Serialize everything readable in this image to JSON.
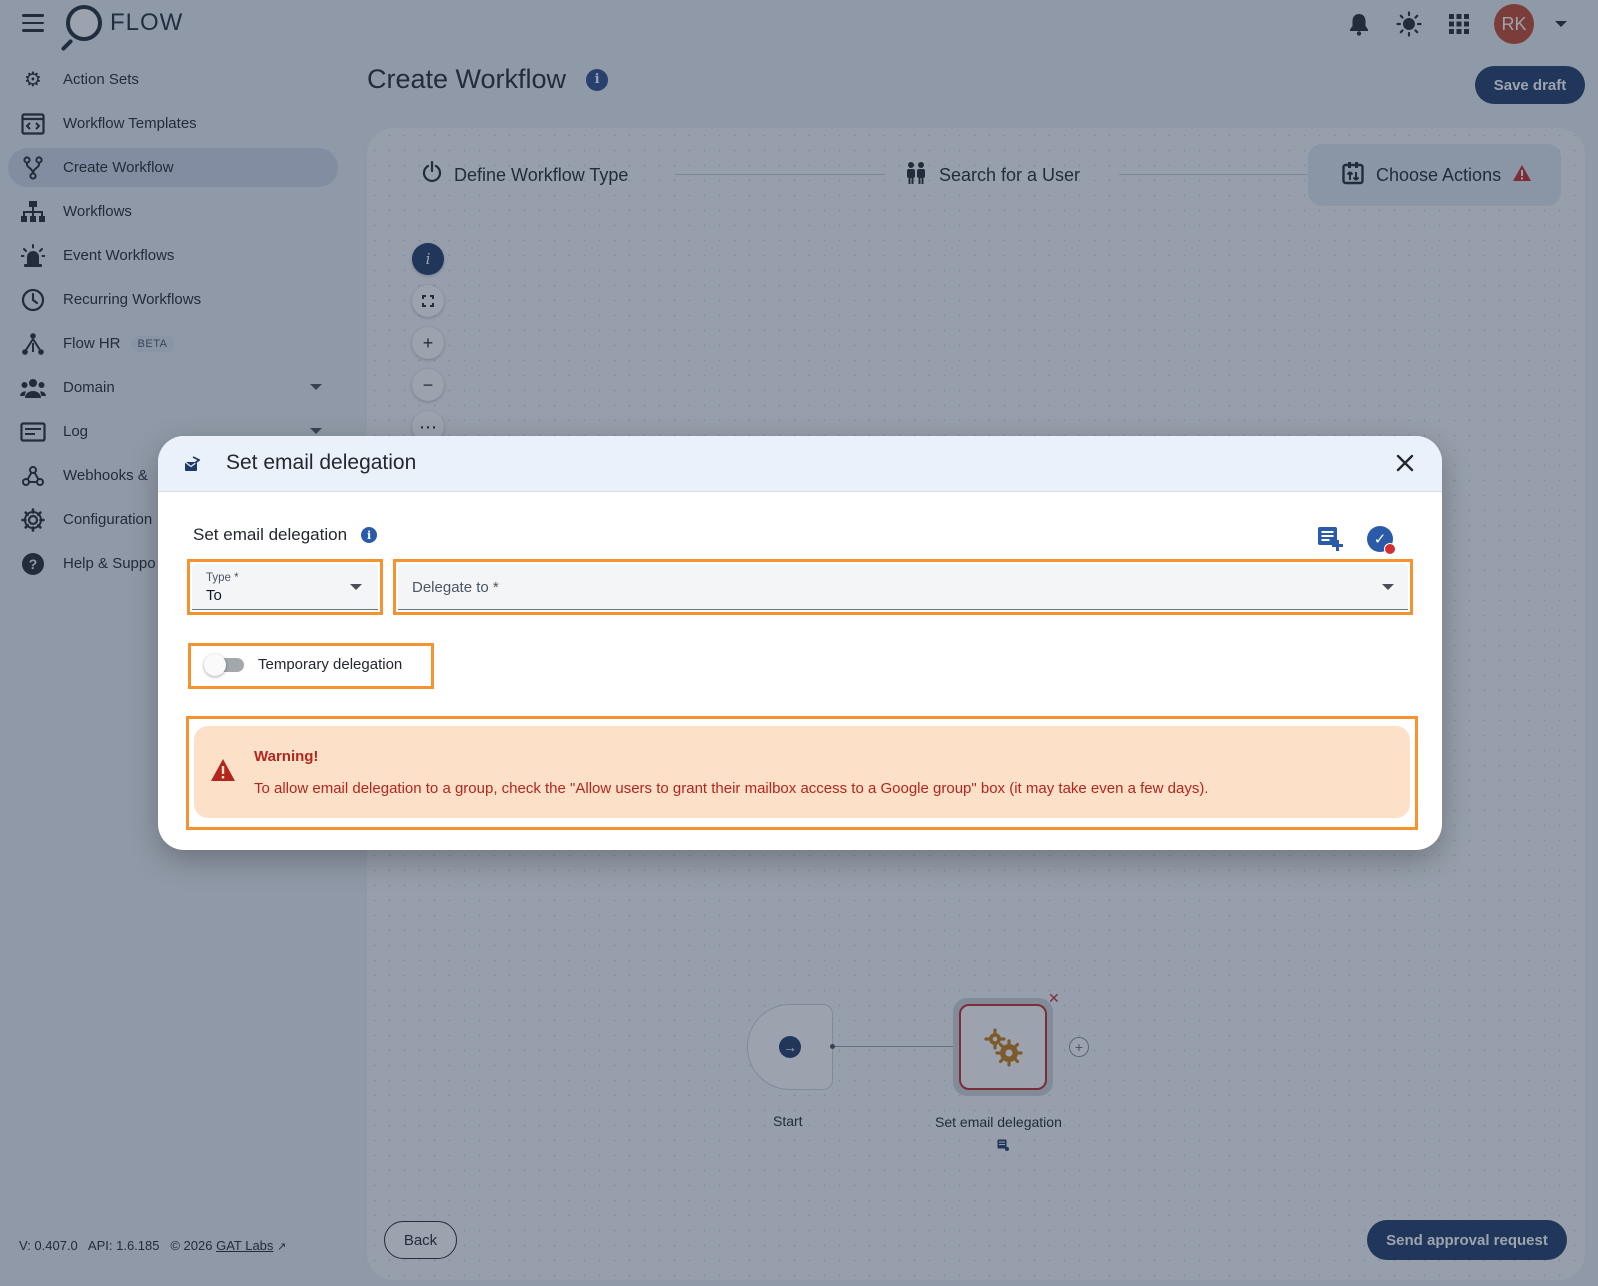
{
  "app": {
    "name": "FLOW"
  },
  "header": {
    "avatar_initials": "RK"
  },
  "sidebar": {
    "items": [
      {
        "label": "Action Sets",
        "icon": "gear-cluster-icon"
      },
      {
        "label": "Workflow Templates",
        "icon": "template-icon"
      },
      {
        "label": "Create Workflow",
        "icon": "branch-icon",
        "active": true
      },
      {
        "label": "Workflows",
        "icon": "sitemap-icon"
      },
      {
        "label": "Event Workflows",
        "icon": "alarm-icon"
      },
      {
        "label": "Recurring Workflows",
        "icon": "clock-icon"
      },
      {
        "label": "Flow HR",
        "icon": "hr-icon",
        "badge": "BETA"
      },
      {
        "label": "Domain",
        "icon": "users-icon",
        "expandable": true
      },
      {
        "label": "Log",
        "icon": "log-icon",
        "expandable": true
      },
      {
        "label": "Webhooks &",
        "icon": "webhook-icon"
      },
      {
        "label": "Configuration",
        "icon": "settings-icon"
      },
      {
        "label": "Help & Suppo",
        "icon": "help-icon"
      }
    ],
    "version": "V: 0.407.0",
    "api": "API: 1.6.185",
    "copyright": "© 2026",
    "company_link": "GAT Labs"
  },
  "page": {
    "title": "Create Workflow",
    "save_draft": "Save draft",
    "steps": [
      {
        "label": "Define Workflow Type",
        "icon": "power-icon"
      },
      {
        "label": "Search for a User",
        "icon": "people-icon"
      },
      {
        "label": "Choose Actions",
        "icon": "actions-icon",
        "active": true,
        "warning": true
      }
    ],
    "canvas": {
      "start_label": "Start",
      "action_label": "Set email delegation"
    },
    "back": "Back",
    "send": "Send approval request"
  },
  "dialog": {
    "title": "Set email delegation",
    "section_title": "Set email delegation",
    "type_field": {
      "label": "Type *",
      "value": "To"
    },
    "delegate_field": {
      "placeholder": "Delegate to *"
    },
    "toggle_label": "Temporary delegation",
    "toggle_on": false,
    "warning": {
      "title": "Warning!",
      "text": "To allow email delegation to a group, check the \"Allow users to grant their mailbox access to a Google group\" box (it may take even a few days)."
    }
  },
  "colors": {
    "primary": "#1e3a66",
    "highlight": "#f59331",
    "warning_bg": "#fde0c8",
    "warning_text": "#b3261e",
    "avatar": "#c4452a"
  }
}
